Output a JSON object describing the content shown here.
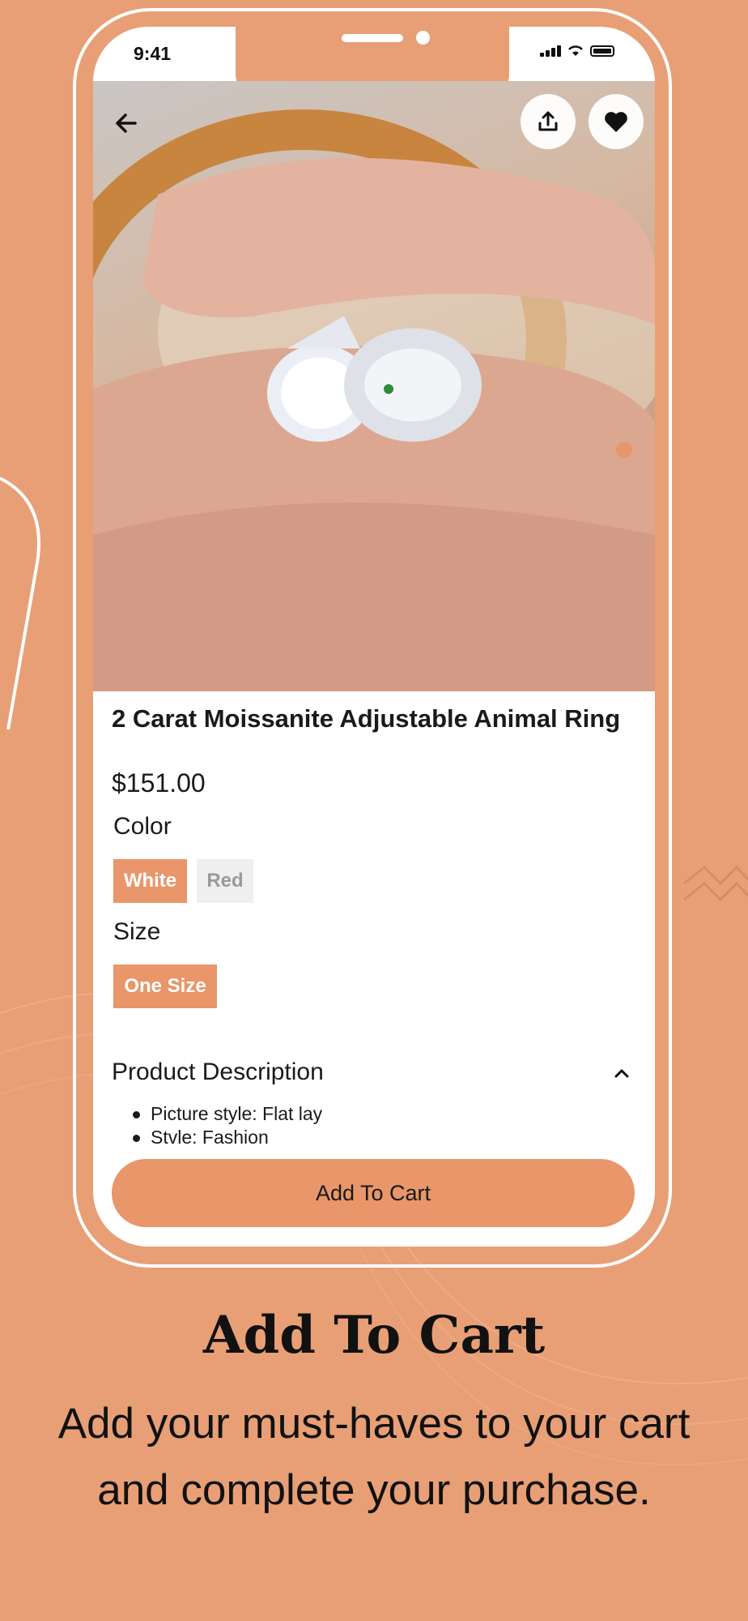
{
  "status_bar": {
    "time": "9:41"
  },
  "product": {
    "title": "2 Carat Moissanite Adjustable Animal Ring",
    "price": "$151.00"
  },
  "options": {
    "color_label": "Color",
    "colors": [
      "White",
      "Red"
    ],
    "selected_color": "White",
    "size_label": "Size",
    "sizes": [
      "One Size"
    ],
    "selected_size": "One Size"
  },
  "description": {
    "title": "Product Description",
    "bullets": [
      "Picture style: Flat lay",
      "Stvle: Fashion"
    ]
  },
  "cart_button_label": "Add To Cart",
  "promo": {
    "headline": "Add To Cart",
    "subline": "Add your must-haves to your cart and complete your purchase."
  },
  "icons": [
    "back-arrow-icon",
    "share-icon",
    "heart-icon",
    "chevron-up-icon",
    "signal-icon",
    "wifi-icon",
    "battery-icon"
  ],
  "colors": {
    "accent": "#E8966A",
    "background": "#E89F75",
    "chip_unselected": "#EFEFEF"
  }
}
